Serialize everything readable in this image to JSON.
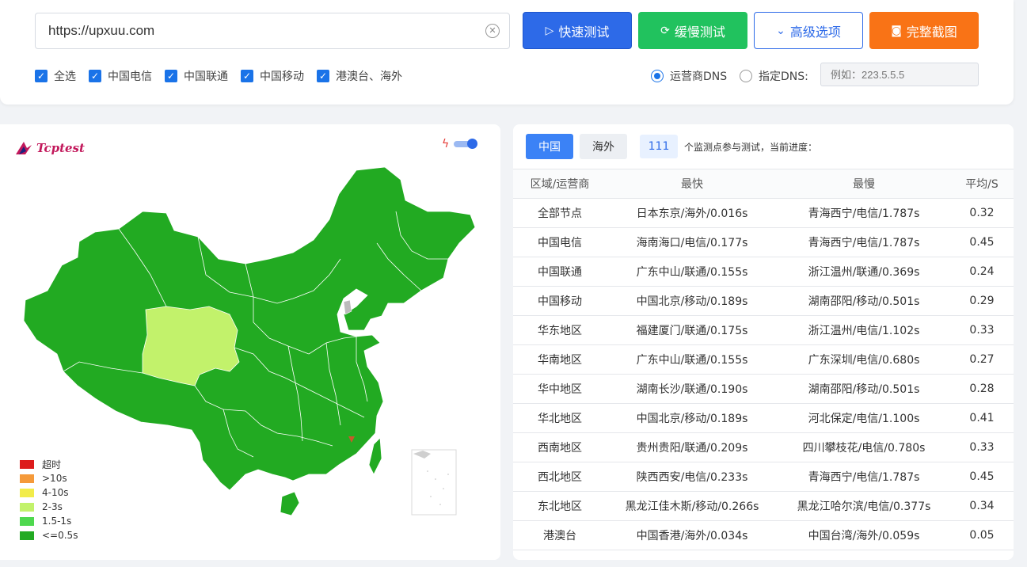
{
  "url_bar": {
    "value": "https://upxuu.com"
  },
  "buttons": {
    "quick": "快速测试",
    "slow": "缓慢测试",
    "advanced": "高级选项",
    "screenshot": "完整截图"
  },
  "checkboxes": [
    {
      "label": "全选",
      "checked": true
    },
    {
      "label": "中国电信",
      "checked": true
    },
    {
      "label": "中国联通",
      "checked": true
    },
    {
      "label": "中国移动",
      "checked": true
    },
    {
      "label": "港澳台、海外",
      "checked": true
    }
  ],
  "dns": {
    "option_isp": "运营商DNS",
    "option_custom": "指定DNS:",
    "selected": "运营商DNS",
    "custom_placeholder": "例如：223.5.5.5"
  },
  "map": {
    "logo": "Tcptest",
    "legend": [
      {
        "label": "超时",
        "color": "#dd1c1c"
      },
      {
        "label": ">10s",
        "color": "#f59a3a"
      },
      {
        "label": "4-10s",
        "color": "#f2ec4a"
      },
      {
        "label": "2-3s",
        "color": "#c2f26b"
      },
      {
        "label": "1.5-1s",
        "color": "#4ed84e"
      },
      {
        "label": "<=0.5s",
        "color": "#22aa22"
      }
    ]
  },
  "results": {
    "tabs": [
      "中国",
      "海外"
    ],
    "active_tab": "中国",
    "node_count": "111",
    "count_text": "个监测点参与测试，当前进度：",
    "headers": [
      "区域/运营商",
      "最快",
      "最慢",
      "平均/S"
    ],
    "rows": [
      [
        "全部节点",
        "日本东京/海外/0.016s",
        "青海西宁/电信/1.787s",
        "0.32"
      ],
      [
        "中国电信",
        "海南海口/电信/0.177s",
        "青海西宁/电信/1.787s",
        "0.45"
      ],
      [
        "中国联通",
        "广东中山/联通/0.155s",
        "浙江温州/联通/0.369s",
        "0.24"
      ],
      [
        "中国移动",
        "中国北京/移动/0.189s",
        "湖南邵阳/移动/0.501s",
        "0.29"
      ],
      [
        "华东地区",
        "福建厦门/联通/0.175s",
        "浙江温州/电信/1.102s",
        "0.33"
      ],
      [
        "华南地区",
        "广东中山/联通/0.155s",
        "广东深圳/电信/0.680s",
        "0.27"
      ],
      [
        "华中地区",
        "湖南长沙/联通/0.190s",
        "湖南邵阳/移动/0.501s",
        "0.28"
      ],
      [
        "华北地区",
        "中国北京/移动/0.189s",
        "河北保定/电信/1.100s",
        "0.41"
      ],
      [
        "西南地区",
        "贵州贵阳/联通/0.209s",
        "四川攀枝花/电信/0.780s",
        "0.33"
      ],
      [
        "西北地区",
        "陕西西安/电信/0.233s",
        "青海西宁/电信/1.787s",
        "0.45"
      ],
      [
        "东北地区",
        "黑龙江佳木斯/移动/0.266s",
        "黑龙江哈尔滨/电信/0.377s",
        "0.34"
      ],
      [
        "港澳台",
        "中国香港/海外/0.034s",
        "中国台湾/海外/0.059s",
        "0.05"
      ]
    ]
  }
}
